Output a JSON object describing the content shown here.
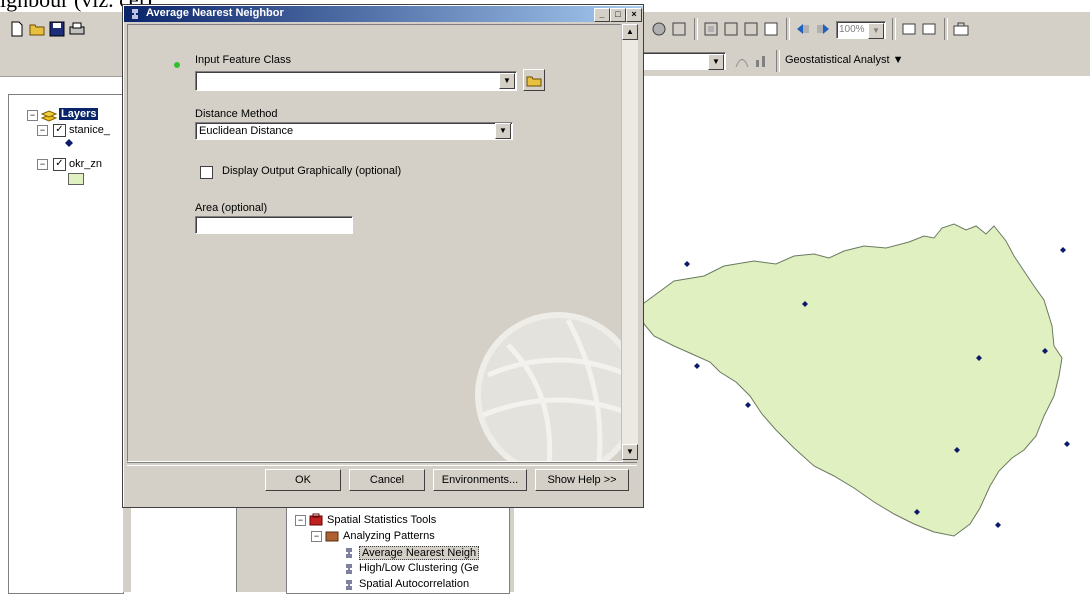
{
  "doc_fragment": "ighbour (viz. cel).",
  "toolbar": {
    "zoom_value": "100%",
    "geostat_label": "Geostatistical Analyst ▼"
  },
  "toc": {
    "root_label": "Layers",
    "layers": [
      {
        "label": "stanice_"
      },
      {
        "label": "okr_zn"
      }
    ]
  },
  "dialog": {
    "title": "Average Nearest Neighbor",
    "caption_buttons": [
      "_",
      "□",
      "×"
    ],
    "input_feature_class_label": "Input Feature Class",
    "input_feature_class_value": "",
    "distance_method_label": "Distance Method",
    "distance_method_value": "Euclidean Distance",
    "display_output_label": "Display Output Graphically (optional)",
    "display_output_checked": false,
    "area_label": "Area (optional)",
    "area_value": "",
    "buttons": {
      "ok": "OK",
      "cancel": "Cancel",
      "environments": "Environments...",
      "show_help": "Show Help >>"
    }
  },
  "toolbox": {
    "items": [
      {
        "label": "Spatial Statistics Tools"
      },
      {
        "label": "Analyzing Patterns"
      },
      {
        "label": "Average Nearest Neigh"
      },
      {
        "label": "High/Low Clustering (Ge"
      },
      {
        "label": "Spatial Autocorrelation"
      }
    ]
  },
  "colors": {
    "map_fill": "#e0f0c0",
    "map_stroke": "#6a7a60",
    "point": "#0b1a6b",
    "title_bar_start": "#0a246a",
    "title_bar_end": "#a6caf0"
  }
}
